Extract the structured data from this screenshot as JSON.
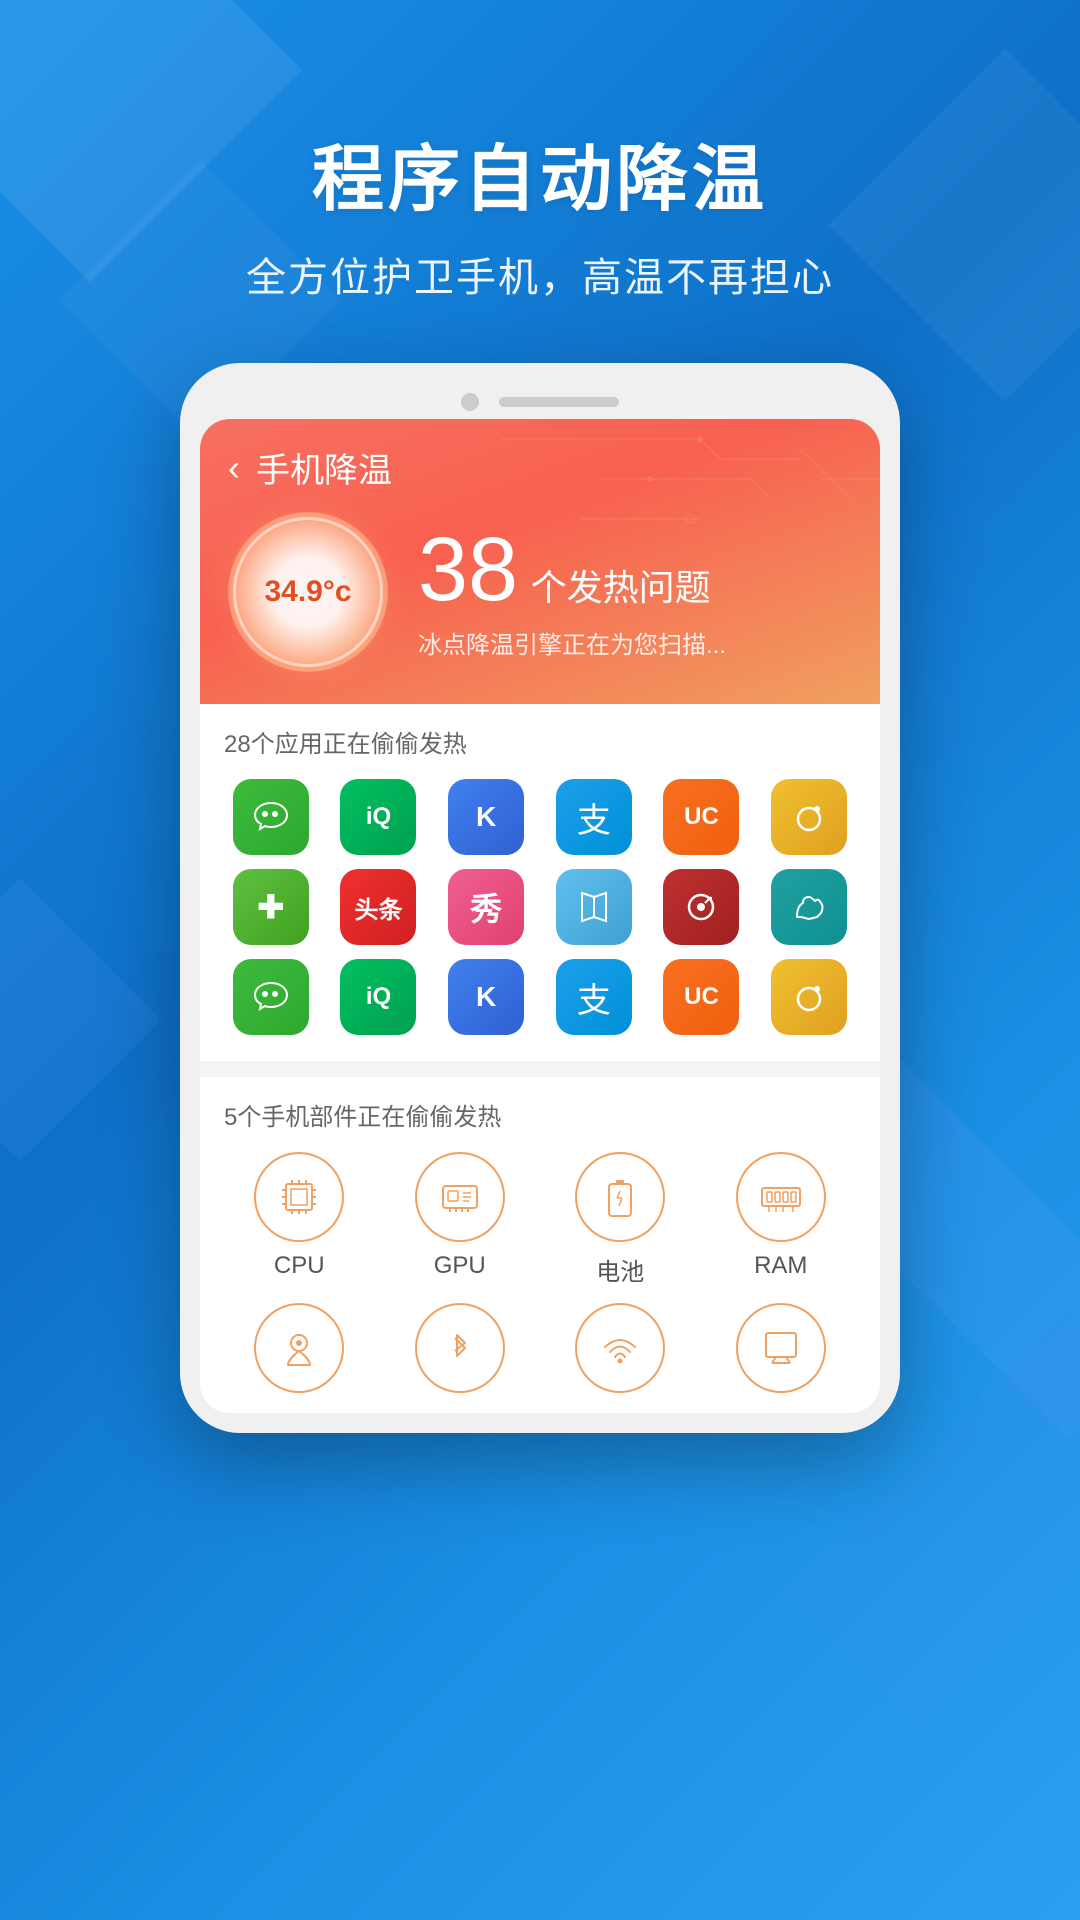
{
  "background": {
    "color_top": "#1a8fe3",
    "color_bottom": "#0e70c8"
  },
  "header": {
    "main_title": "程序自动降温",
    "sub_title": "全方位护卫手机，高温不再担心"
  },
  "app_screen": {
    "nav_title": "手机降温",
    "back_label": "‹",
    "temperature": "34.9°c",
    "heat_count": "38",
    "heat_label": "个发热问题",
    "heat_desc": "冰点降温引擎正在为您扫描...",
    "app_section_desc": "28个应用正在偷偷发热",
    "components_section_desc": "5个手机部件正在偷偷发热",
    "apps": [
      {
        "name": "wechat",
        "class": "wechat",
        "label": "微信"
      },
      {
        "name": "iqiyi",
        "class": "iqiyi",
        "label": "爱奇艺"
      },
      {
        "name": "kuwo",
        "class": "kuwo",
        "label": "酷我"
      },
      {
        "name": "alipay",
        "class": "alipay",
        "label": "支付宝"
      },
      {
        "name": "uc",
        "class": "uc",
        "label": "UC"
      },
      {
        "name": "weibo",
        "class": "weibo",
        "label": "微博"
      },
      {
        "name": "medical",
        "class": "medical",
        "label": "医疗"
      },
      {
        "name": "toutiao",
        "class": "toutiao",
        "label": "头条"
      },
      {
        "name": "xiu",
        "class": "xiu",
        "label": "秀"
      },
      {
        "name": "maps",
        "class": "maps",
        "label": "地图"
      },
      {
        "name": "netease",
        "class": "netease",
        "label": "网易"
      },
      {
        "name": "camel",
        "class": "camel",
        "label": "骆驼"
      },
      {
        "name": "wechat2",
        "class": "wechat",
        "label": "微信"
      },
      {
        "name": "iqiyi2",
        "class": "iqiyi",
        "label": "爱奇艺"
      },
      {
        "name": "kuwo2",
        "class": "kuwo",
        "label": "酷我"
      },
      {
        "name": "alipay2",
        "class": "alipay",
        "label": "支付宝"
      },
      {
        "name": "uc2",
        "class": "uc",
        "label": "UC"
      },
      {
        "name": "weibo2",
        "class": "weibo",
        "label": "微博"
      }
    ],
    "components": [
      {
        "name": "cpu",
        "label": "CPU",
        "icon": "cpu"
      },
      {
        "name": "gpu",
        "label": "GPU",
        "icon": "gpu"
      },
      {
        "name": "battery",
        "label": "电池",
        "icon": "battery"
      },
      {
        "name": "ram",
        "label": "RAM",
        "icon": "ram"
      }
    ],
    "components_row2": [
      {
        "name": "location",
        "label": "",
        "icon": "location"
      },
      {
        "name": "bluetooth",
        "label": "",
        "icon": "bluetooth"
      },
      {
        "name": "wifi",
        "label": "",
        "icon": "wifi"
      },
      {
        "name": "screen",
        "label": "",
        "icon": "screen"
      }
    ]
  }
}
